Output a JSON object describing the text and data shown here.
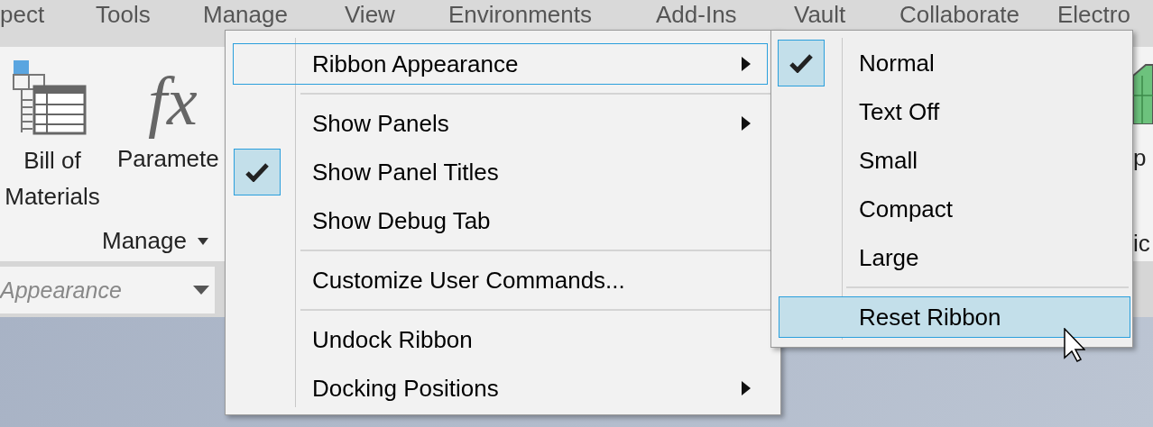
{
  "tabs": [
    {
      "label": "pect"
    },
    {
      "label": "Tools"
    },
    {
      "label": "Manage"
    },
    {
      "label": "View"
    },
    {
      "label": "Environments"
    },
    {
      "label": "Add-Ins"
    },
    {
      "label": "Vault"
    },
    {
      "label": "Collaborate"
    },
    {
      "label": "Electro"
    }
  ],
  "ribbon": {
    "buttons": [
      {
        "kind": "bom",
        "label_lines": [
          "Bill of",
          "Materials"
        ]
      },
      {
        "kind": "formula",
        "icon_text": "fx",
        "label_lines": [
          "Paramete"
        ]
      }
    ],
    "panel_title": "Manage",
    "right_fragments": [
      "p",
      "ic"
    ],
    "style_field": {
      "placeholder": "Appearance"
    }
  },
  "context_menu": {
    "items": [
      {
        "kind": "item",
        "label": "Ribbon Appearance",
        "submenu": true,
        "checked": false,
        "selected": true
      },
      {
        "kind": "separator"
      },
      {
        "kind": "item",
        "label": "Show Panels",
        "submenu": true,
        "checked": false,
        "selected": false
      },
      {
        "kind": "item",
        "label": "Show Panel Titles",
        "submenu": false,
        "checked": true,
        "selected": false
      },
      {
        "kind": "item",
        "label": "Show Debug Tab",
        "submenu": false,
        "checked": false,
        "selected": false
      },
      {
        "kind": "separator"
      },
      {
        "kind": "item",
        "label": "Customize User Commands...",
        "submenu": false,
        "checked": false,
        "selected": false
      },
      {
        "kind": "separator"
      },
      {
        "kind": "item",
        "label": "Undock Ribbon",
        "submenu": false,
        "checked": false,
        "selected": false
      },
      {
        "kind": "item",
        "label": "Docking Positions",
        "submenu": true,
        "checked": false,
        "selected": false
      }
    ]
  },
  "submenu": {
    "items": [
      {
        "kind": "item",
        "label": "Normal",
        "submenu": false,
        "checked": true,
        "selected": false
      },
      {
        "kind": "item",
        "label": "Text Off",
        "submenu": false,
        "checked": false,
        "selected": false
      },
      {
        "kind": "item",
        "label": "Small",
        "submenu": false,
        "checked": false,
        "selected": false
      },
      {
        "kind": "item",
        "label": "Compact",
        "submenu": false,
        "checked": false,
        "selected": false
      },
      {
        "kind": "item",
        "label": "Large",
        "submenu": false,
        "checked": false,
        "selected": false
      },
      {
        "kind": "separator"
      },
      {
        "kind": "item",
        "label": "Reset Ribbon",
        "submenu": false,
        "checked": false,
        "selected": true
      }
    ]
  }
}
